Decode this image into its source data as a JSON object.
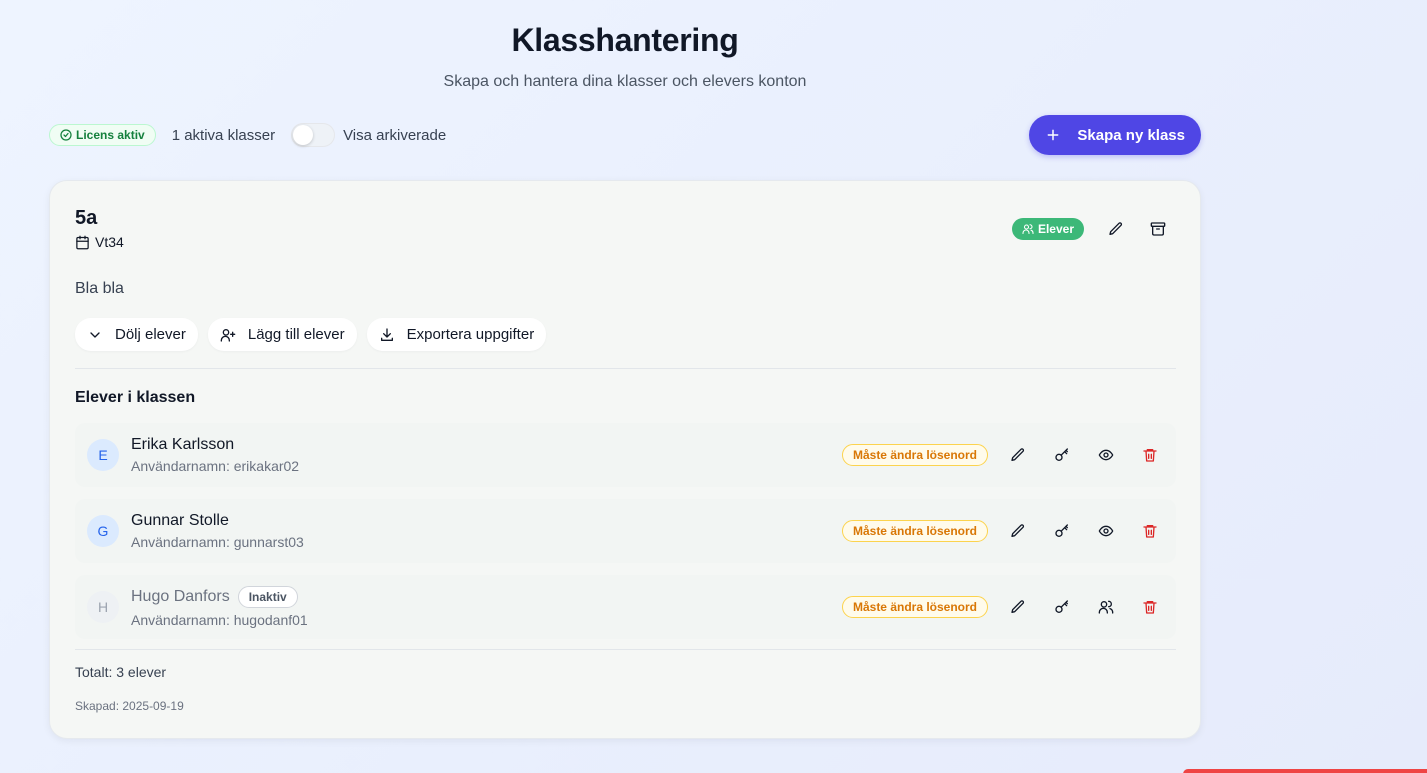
{
  "header": {
    "title": "Klasshantering",
    "subtitle": "Skapa och hantera dina klasser och elevers konton"
  },
  "toolbar": {
    "license_label": "Licens aktiv",
    "active_classes": "1 aktiva klasser",
    "show_archived_label": "Visa arkiverade",
    "show_archived_on": false,
    "create_button": "Skapa ny klass"
  },
  "class_card": {
    "name": "5a",
    "term": "Vt34",
    "students_badge": "Elever",
    "description": "Bla bla",
    "actions": {
      "hide_students": "Dölj elever",
      "add_students": "Lägg till elever",
      "export_tasks": "Exportera uppgifter"
    },
    "section_title": "Elever i klassen",
    "students": [
      {
        "initial": "E",
        "name": "Erika Karlsson",
        "username": "Användarnamn: erikakar02",
        "status": "Måste ändra lösenord",
        "active": true
      },
      {
        "initial": "G",
        "name": "Gunnar Stolle",
        "username": "Användarnamn: gunnarst03",
        "status": "Måste ändra lösenord",
        "active": true
      },
      {
        "initial": "H",
        "name": "Hugo Danfors",
        "username": "Användarnamn: hugodanf01",
        "status": "Måste ändra lösenord",
        "active": false,
        "inactive_label": "Inaktiv"
      }
    ],
    "total": "Totalt: 3 elever",
    "created": "Skapad: 2025-09-19"
  },
  "colors": {
    "accent": "#4f46e5",
    "success": "#3cb878",
    "warning": "#d97706",
    "danger": "#dc2626"
  },
  "icons": {
    "license": "check-circle-icon",
    "create": "plus-icon",
    "term": "calendar-icon",
    "students_badge": "users-icon",
    "edit": "pencil-icon",
    "archive": "archive-icon",
    "hide": "chevron-down-icon",
    "add": "user-plus-icon",
    "export": "download-icon",
    "password": "key-icon",
    "view": "eye-icon",
    "delete": "trash-icon"
  }
}
